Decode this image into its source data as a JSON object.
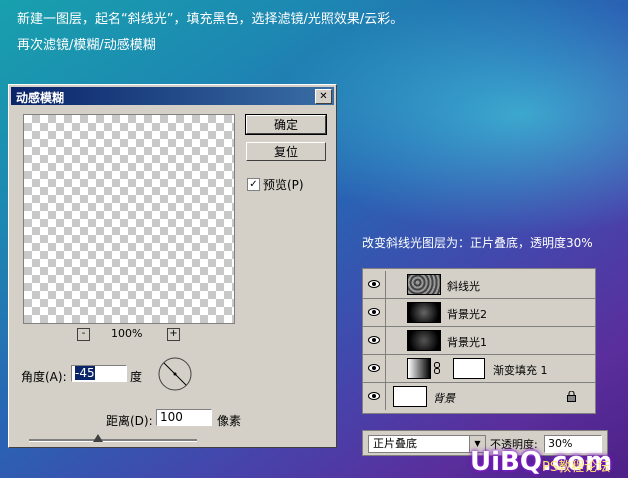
{
  "instructions": {
    "line1": "新建一图层，起名“斜线光”，填充黑色，选择滤镜/光照效果/云彩。",
    "line2": "再次滤镜/模糊/动感模糊"
  },
  "dialog": {
    "title": "动感模糊",
    "close_label": "✕",
    "ok_label": "确定",
    "reset_label": "复位",
    "preview_label": "预览(P)",
    "preview_checked": "✓",
    "zoom_out": "-",
    "zoom_in": "+",
    "zoom_level": "100%",
    "angle_label": "角度(A):",
    "angle_value": "-45",
    "angle_unit": "度",
    "distance_label": "距离(D):",
    "distance_value": "100",
    "distance_unit": "像素"
  },
  "caption": "改变斜线光图层为：正片叠底，透明度30%",
  "layers": [
    {
      "name": "斜线光",
      "thumb": "noise",
      "visible": true
    },
    {
      "name": "背景光2",
      "thumb": "dark-radial",
      "visible": true
    },
    {
      "name": "背景光1",
      "thumb": "dark-radial",
      "visible": true
    },
    {
      "name": "渐变填充 1",
      "thumb": "gradient",
      "visible": true
    },
    {
      "name": "背景",
      "thumb": "white",
      "visible": true,
      "locked": true
    }
  ],
  "blend": {
    "mode": "正片叠底",
    "opacity_label": "不透明度:",
    "opacity_value": "30%"
  },
  "watermark": {
    "brand": "UiBQ.com",
    "cn": "PS教程论坛"
  },
  "colors": {
    "selection": "#0a246a",
    "dialog_bg": "#d4d0c8"
  }
}
